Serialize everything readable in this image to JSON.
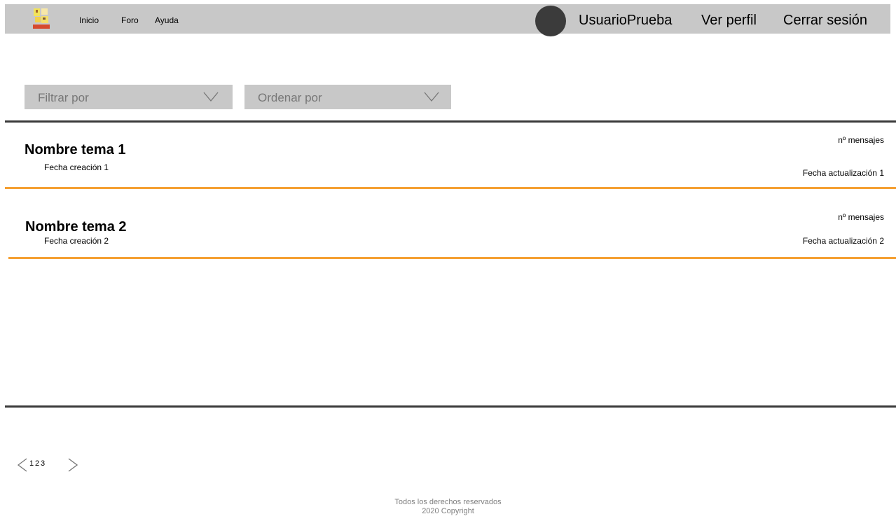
{
  "header": {
    "logo_icon": "ducks-logo-icon",
    "nav": [
      {
        "label": "Inicio"
      },
      {
        "label": "Foro"
      },
      {
        "label": "Ayuda"
      }
    ],
    "avatar_icon": "user-avatar-icon",
    "username": "UsuarioPrueba",
    "profile_label": "Ver perfil",
    "logout_label": "Cerrar sesión"
  },
  "filters": {
    "filter_placeholder": "Filtrar por",
    "order_placeholder": "Ordenar por",
    "chevron_icon": "chevron-down-icon"
  },
  "topics": [
    {
      "title": "Nombre tema 1",
      "created": "Fecha creación 1",
      "messages": "nº mensajes",
      "updated": "Fecha actualización 1"
    },
    {
      "title": "Nombre tema 2",
      "created": "Fecha creación 2",
      "messages": "nº mensajes",
      "updated": "Fecha actualización 2"
    }
  ],
  "pagination": {
    "prev_icon": "chevron-left-icon",
    "next_icon": "chevron-right-icon",
    "pages": [
      "1",
      "2",
      "3"
    ]
  },
  "footer": {
    "line1": "Todos los derechos reservados",
    "line2": "2020 Copyright"
  },
  "colors": {
    "bar_gray": "#c8c8c8",
    "divider_dark": "#3a3a3a",
    "divider_accent": "#f5a033",
    "placeholder_text": "#777777",
    "footer_text": "#808080"
  }
}
